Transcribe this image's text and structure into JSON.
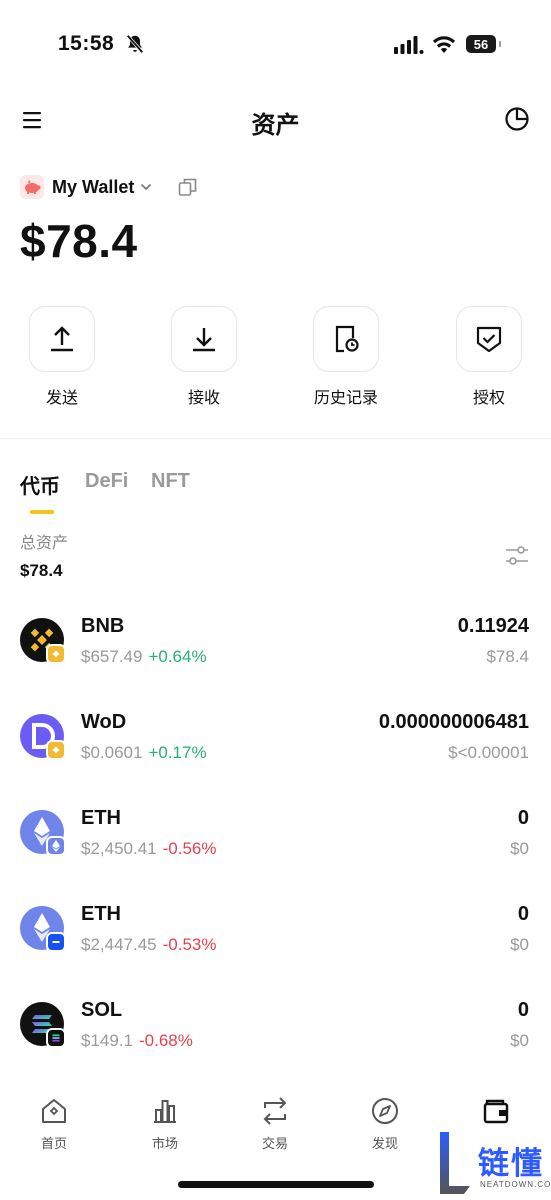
{
  "status_bar": {
    "time": "15:58",
    "battery": "56"
  },
  "header": {
    "title": "资产"
  },
  "wallet": {
    "name": "My Wallet",
    "balance": "$78.4"
  },
  "actions": [
    {
      "label": "发送"
    },
    {
      "label": "接收"
    },
    {
      "label": "历史记录"
    },
    {
      "label": "授权"
    }
  ],
  "tabs": [
    {
      "label": "代币",
      "active": true
    },
    {
      "label": "DeFi",
      "active": false
    },
    {
      "label": "NFT",
      "active": false
    }
  ],
  "summary": {
    "label": "总资产",
    "value": "$78.4"
  },
  "tokens": [
    {
      "symbol": "BNB",
      "price": "$657.49",
      "change": "+0.64%",
      "direction": "up",
      "amount": "0.11924",
      "value": "$78.4"
    },
    {
      "symbol": "WoD",
      "price": "$0.0601",
      "change": "+0.17%",
      "direction": "up",
      "amount": "0.000000006481",
      "value": "$<0.00001"
    },
    {
      "symbol": "ETH",
      "price": "$2,450.41",
      "change": "-0.56%",
      "direction": "down",
      "amount": "0",
      "value": "$0"
    },
    {
      "symbol": "ETH",
      "price": "$2,447.45",
      "change": "-0.53%",
      "direction": "down",
      "amount": "0",
      "value": "$0"
    },
    {
      "symbol": "SOL",
      "price": "$149.1",
      "change": "-0.68%",
      "direction": "down",
      "amount": "0",
      "value": "$0"
    }
  ],
  "nav": [
    {
      "label": "首页"
    },
    {
      "label": "市场"
    },
    {
      "label": "交易"
    },
    {
      "label": "发现"
    }
  ],
  "watermark": {
    "text": "链懂",
    "sub": "NEATDOWN.COM"
  },
  "colors": {
    "positive": "#23b26d",
    "negative": "#e5414f",
    "accent": "#f3c31b",
    "bnb": "#f3ba2f"
  }
}
